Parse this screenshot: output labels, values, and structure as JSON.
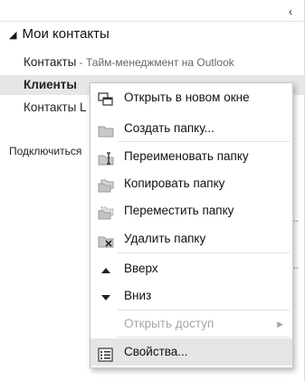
{
  "nav": {
    "collapse_glyph": "‹",
    "group_title": "Мои контакты",
    "folders": [
      {
        "name": "Контакты",
        "sub": " - Тайм-менеджмент на Outlook"
      },
      {
        "name": "Клиенты",
        "sub": ""
      },
      {
        "name": "Контакты L",
        "sub": ""
      }
    ],
    "connect_text": "Подключиться",
    "dots": "..."
  },
  "menu": {
    "items": [
      {
        "label": "Открыть в новом окне",
        "hotkey": "О",
        "icon": "new-window-icon",
        "enabled": true
      },
      {
        "label": "Создать папку...",
        "hotkey": "С",
        "icon": "new-folder-icon",
        "enabled": true
      },
      {
        "label": "Переименовать папку",
        "hotkey": "П",
        "icon": "rename-folder-icon",
        "enabled": true
      },
      {
        "label": "Копировать папку",
        "hotkey": "К",
        "icon": "copy-folder-icon",
        "enabled": true
      },
      {
        "label": "Переместить папку",
        "hotkey": "П",
        "icon": "move-folder-icon",
        "enabled": true
      },
      {
        "label": "Удалить папку",
        "hotkey": "У",
        "icon": "delete-folder-icon",
        "enabled": true
      },
      {
        "label": "Вверх",
        "hotkey": "х",
        "icon": "move-up-icon",
        "enabled": true
      },
      {
        "label": "Вниз",
        "hotkey": "н",
        "icon": "move-down-icon",
        "enabled": true
      },
      {
        "label": "Открыть доступ",
        "hotkey": "",
        "icon": "",
        "enabled": false
      },
      {
        "label": "Свойства...",
        "hotkey": "С",
        "icon": "properties-icon",
        "enabled": true
      }
    ]
  },
  "colors": {
    "selection": "#e6e6e6",
    "hover": "#e5e5e5",
    "disabled_text": "#a6a6a6"
  }
}
